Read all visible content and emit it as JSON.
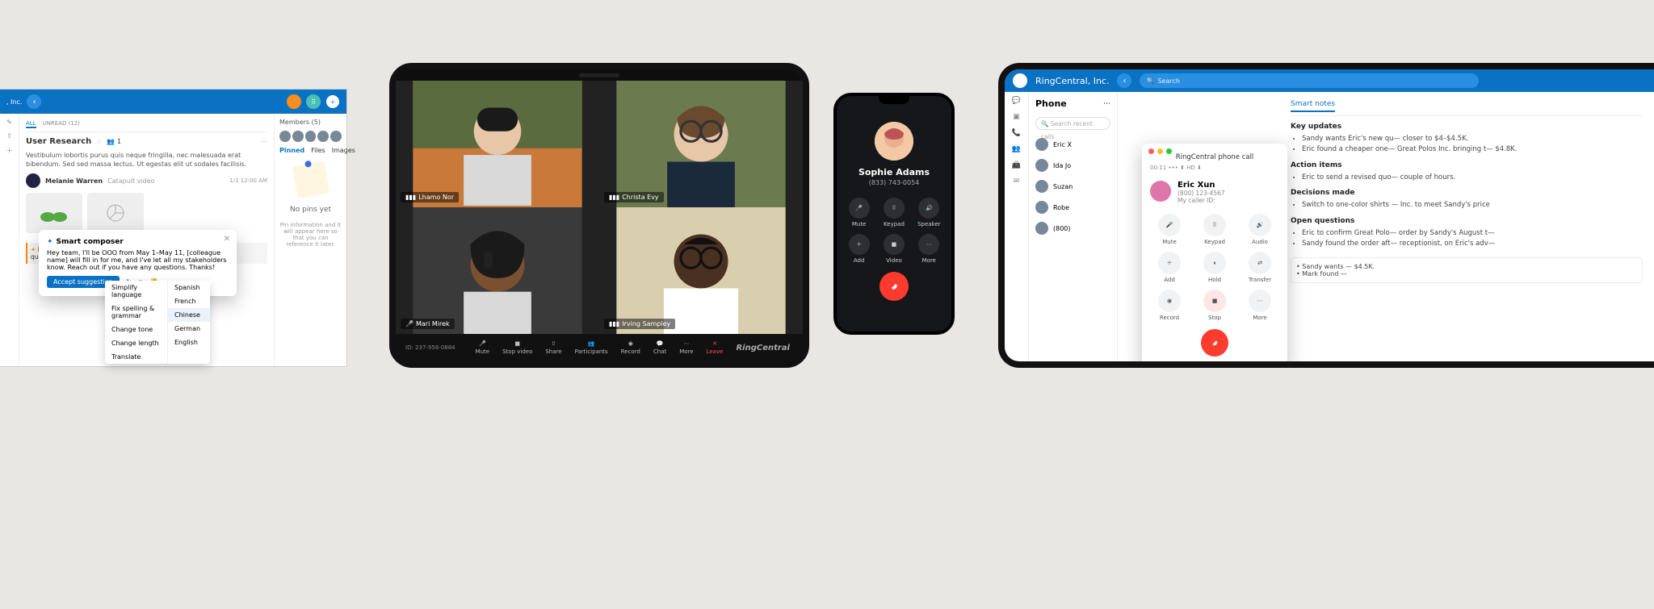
{
  "desktop": {
    "appTitle": ", Inc.",
    "tabs": {
      "all": "ALL",
      "unread": "UNREAD (12)"
    },
    "channel": {
      "name": "User Research",
      "starCount": "1"
    },
    "message": {
      "body": "Vestibulum lobortis purus quis neque fringilla, nec malesuada erat bibendum. Sed sed massa lectus. Ut egestas elit ut sodales facilisis.",
      "author": "Melanie Warren",
      "role": "Catapult video",
      "time": "1/1  12:00 AM"
    },
    "sidebar": {
      "members": "Members (5)",
      "pinned": "Pinned",
      "files": "Files",
      "images": "Images",
      "noPins": "No pins yet",
      "noPinsSub": "Pin information and it will appear here so that you can reference it later."
    },
    "composer": {
      "title": "Smart composer",
      "body": "Hey team, I'll be OOO from May 1–May 11, [colleague name] will fill in for me, and I've let all my stakeholders know. Reach out if you have any questions. Thanks!",
      "accept": "Accept suggestion",
      "menu": [
        "Simplify language",
        "Fix spelling & grammar",
        "Change tone",
        "Change length",
        "Translate"
      ],
      "langs": [
        "Spanish",
        "French",
        "Chinese",
        "German",
        "English"
      ]
    },
    "quote": "Hey team — in for me. and I've let all my stakeholders know. any questions. Thanks!"
  },
  "meeting": {
    "participants": [
      "Lhamo Nor",
      "Christa Evy",
      "Mari Mirek",
      "Irving Sampley"
    ],
    "id": "ID: 237-956-0884",
    "controls": [
      "Mute",
      "Stop video",
      "Share",
      "Participants",
      "Record",
      "Chat",
      "More",
      "Leave"
    ],
    "brand": "RingCentral"
  },
  "phone": {
    "name": "Sophie Adams",
    "number": "(833) 743-0054",
    "controls": [
      "Mute",
      "Keypad",
      "Speaker",
      "Add",
      "Video",
      "More"
    ]
  },
  "tablet2": {
    "title": "RingCentral, Inc.",
    "searchPh": "Search",
    "pane": {
      "heading": "Phone",
      "search": "Search recent calls",
      "contacts": [
        "Eric X",
        "Ida Jo",
        "Suzan",
        "Robe",
        "(800)"
      ]
    },
    "call": {
      "header": "RingCentral phone call",
      "status": "00:11  ••• ⬆ HD ⬇",
      "name": "Eric Xun",
      "number": "(800) 123-4567",
      "callerId": "My caller ID:",
      "controls": [
        "Mute",
        "Keypad",
        "Audio",
        "Add",
        "Hold",
        "Transfer",
        "Record",
        "Stop",
        "More"
      ]
    },
    "notes": {
      "tab": "Smart notes",
      "sections": [
        {
          "h": "Key updates",
          "items": [
            "Sandy wants Eric's new qu— closer to $4–$4.5K.",
            "Eric found a cheaper one— Great Polos Inc. bringing t— $4.8K."
          ]
        },
        {
          "h": "Action items",
          "items": [
            "Eric to send a revised quo— couple of hours."
          ]
        },
        {
          "h": "Decisions made",
          "items": [
            "Switch to one-color shirts — Inc. to meet Sandy's price"
          ]
        },
        {
          "h": "Open questions",
          "items": [
            "Eric to confirm Great Polo— order by Sandy's August t—",
            "Sandy found the order aft— receptionist, on Eric's adv—"
          ]
        }
      ],
      "box": [
        "Sandy wants — $4.5K.",
        "Mark found —"
      ]
    }
  }
}
